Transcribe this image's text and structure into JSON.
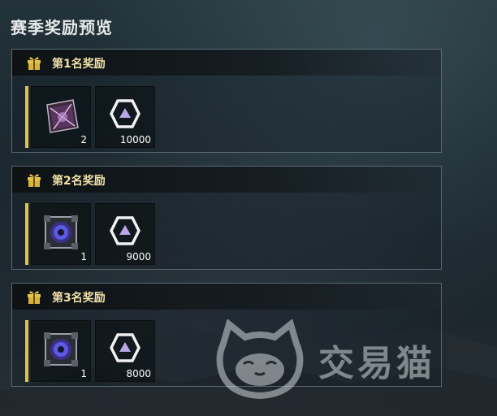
{
  "title": "赛季奖励预览",
  "watermark": "交易猫",
  "ranks": [
    {
      "label": "第1名奖励",
      "item_icon": "purple-crystal-cube-icon",
      "item_qty": "2",
      "currency_icon": "hexagon-token-icon",
      "currency_qty": "10000"
    },
    {
      "label": "第2名奖励",
      "item_icon": "void-portal-cube-icon",
      "item_qty": "1",
      "currency_icon": "hexagon-token-icon",
      "currency_qty": "9000"
    },
    {
      "label": "第3名奖励",
      "item_icon": "void-portal-cube-icon",
      "item_qty": "1",
      "currency_icon": "hexagon-token-icon",
      "currency_qty": "8000"
    }
  ],
  "colors": {
    "accent_gold": "#e3c24a",
    "rank_label": "#f0e0a8",
    "panel_border": "#8ca0aa"
  }
}
